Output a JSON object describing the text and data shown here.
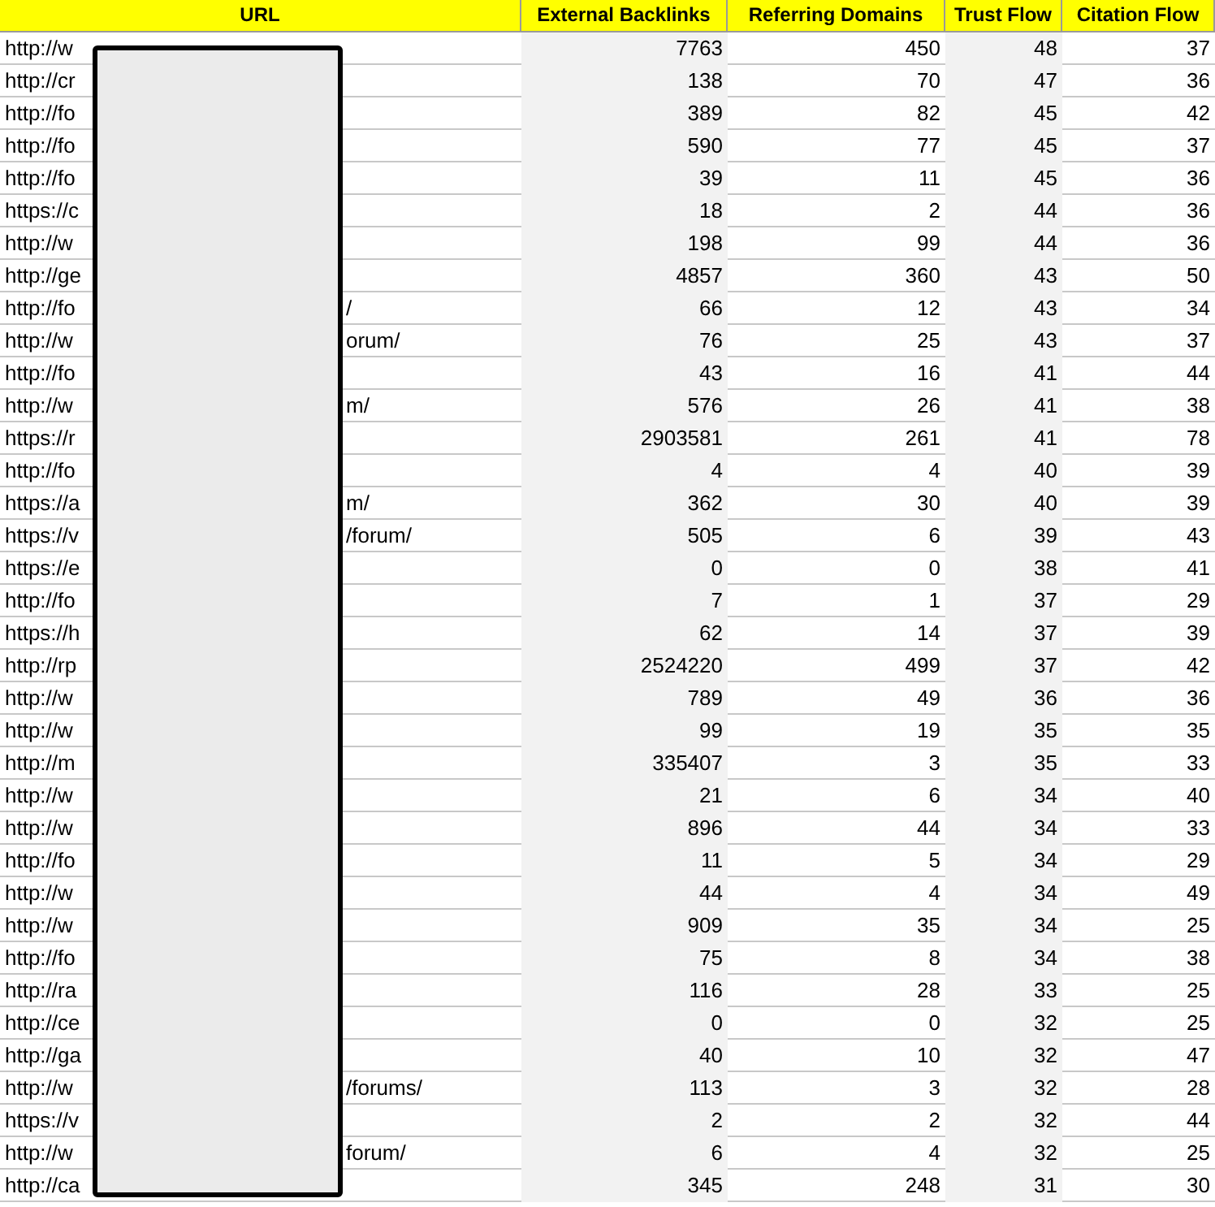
{
  "table": {
    "columns": [
      "URL",
      "External Backlinks",
      "Referring Domains",
      "Trust Flow",
      "Citation Flow"
    ],
    "rows": [
      {
        "url": "http://w",
        "values": [
          "7763",
          "450",
          "48",
          "37"
        ]
      },
      {
        "url": "http://cr",
        "values": [
          "138",
          "70",
          "47",
          "36"
        ]
      },
      {
        "url": "http://fo",
        "values": [
          "389",
          "82",
          "45",
          "42"
        ]
      },
      {
        "url": "http://fo",
        "values": [
          "590",
          "77",
          "45",
          "37"
        ]
      },
      {
        "url": "http://fo",
        "values": [
          "39",
          "11",
          "45",
          "36"
        ]
      },
      {
        "url": "https://c",
        "values": [
          "18",
          "2",
          "44",
          "36"
        ]
      },
      {
        "url": "http://w",
        "values": [
          "198",
          "99",
          "44",
          "36"
        ]
      },
      {
        "url": "http://ge",
        "values": [
          "4857",
          "360",
          "43",
          "50"
        ]
      },
      {
        "url": "http://fo",
        "url_end": "/",
        "values": [
          "66",
          "12",
          "43",
          "34"
        ]
      },
      {
        "url": "http://w",
        "url_end": "orum/",
        "values": [
          "76",
          "25",
          "43",
          "37"
        ]
      },
      {
        "url": "http://fo",
        "values": [
          "43",
          "16",
          "41",
          "44"
        ]
      },
      {
        "url": "http://w",
        "url_end": "m/",
        "values": [
          "576",
          "26",
          "41",
          "38"
        ]
      },
      {
        "url": "https://r",
        "values": [
          "2903581",
          "261",
          "41",
          "78"
        ]
      },
      {
        "url": "http://fo",
        "values": [
          "4",
          "4",
          "40",
          "39"
        ]
      },
      {
        "url": "https://a",
        "url_end": "m/",
        "values": [
          "362",
          "30",
          "40",
          "39"
        ]
      },
      {
        "url": "https://v",
        "url_end": "/forum/",
        "values": [
          "505",
          "6",
          "39",
          "43"
        ]
      },
      {
        "url": "https://e",
        "values": [
          "0",
          "0",
          "38",
          "41"
        ]
      },
      {
        "url": "http://fo",
        "values": [
          "7",
          "1",
          "37",
          "29"
        ]
      },
      {
        "url": "https://h",
        "values": [
          "62",
          "14",
          "37",
          "39"
        ]
      },
      {
        "url": "http://rp",
        "values": [
          "2524220",
          "499",
          "37",
          "42"
        ]
      },
      {
        "url": "http://w",
        "values": [
          "789",
          "49",
          "36",
          "36"
        ]
      },
      {
        "url": "http://w",
        "values": [
          "99",
          "19",
          "35",
          "35"
        ]
      },
      {
        "url": "http://m",
        "values": [
          "335407",
          "3",
          "35",
          "33"
        ]
      },
      {
        "url": "http://w",
        "values": [
          "21",
          "6",
          "34",
          "40"
        ]
      },
      {
        "url": "http://w",
        "values": [
          "896",
          "44",
          "34",
          "33"
        ]
      },
      {
        "url": "http://fo",
        "values": [
          "11",
          "5",
          "34",
          "29"
        ]
      },
      {
        "url": "http://w",
        "values": [
          "44",
          "4",
          "34",
          "49"
        ]
      },
      {
        "url": "http://w",
        "values": [
          "909",
          "35",
          "34",
          "25"
        ]
      },
      {
        "url": "http://fo",
        "values": [
          "75",
          "8",
          "34",
          "38"
        ]
      },
      {
        "url": "http://ra",
        "values": [
          "116",
          "28",
          "33",
          "25"
        ]
      },
      {
        "url": "http://ce",
        "values": [
          "0",
          "0",
          "32",
          "25"
        ]
      },
      {
        "url": "http://ga",
        "values": [
          "40",
          "10",
          "32",
          "47"
        ]
      },
      {
        "url": "http://w",
        "url_end": "/forums/",
        "values": [
          "113",
          "3",
          "32",
          "28"
        ]
      },
      {
        "url": "https://v",
        "values": [
          "2",
          "2",
          "32",
          "44"
        ]
      },
      {
        "url": "http://w",
        "url_end": "forum/",
        "values": [
          "6",
          "4",
          "32",
          "25"
        ]
      },
      {
        "url": "http://ca",
        "values": [
          "345",
          "248",
          "31",
          "30"
        ]
      }
    ]
  }
}
